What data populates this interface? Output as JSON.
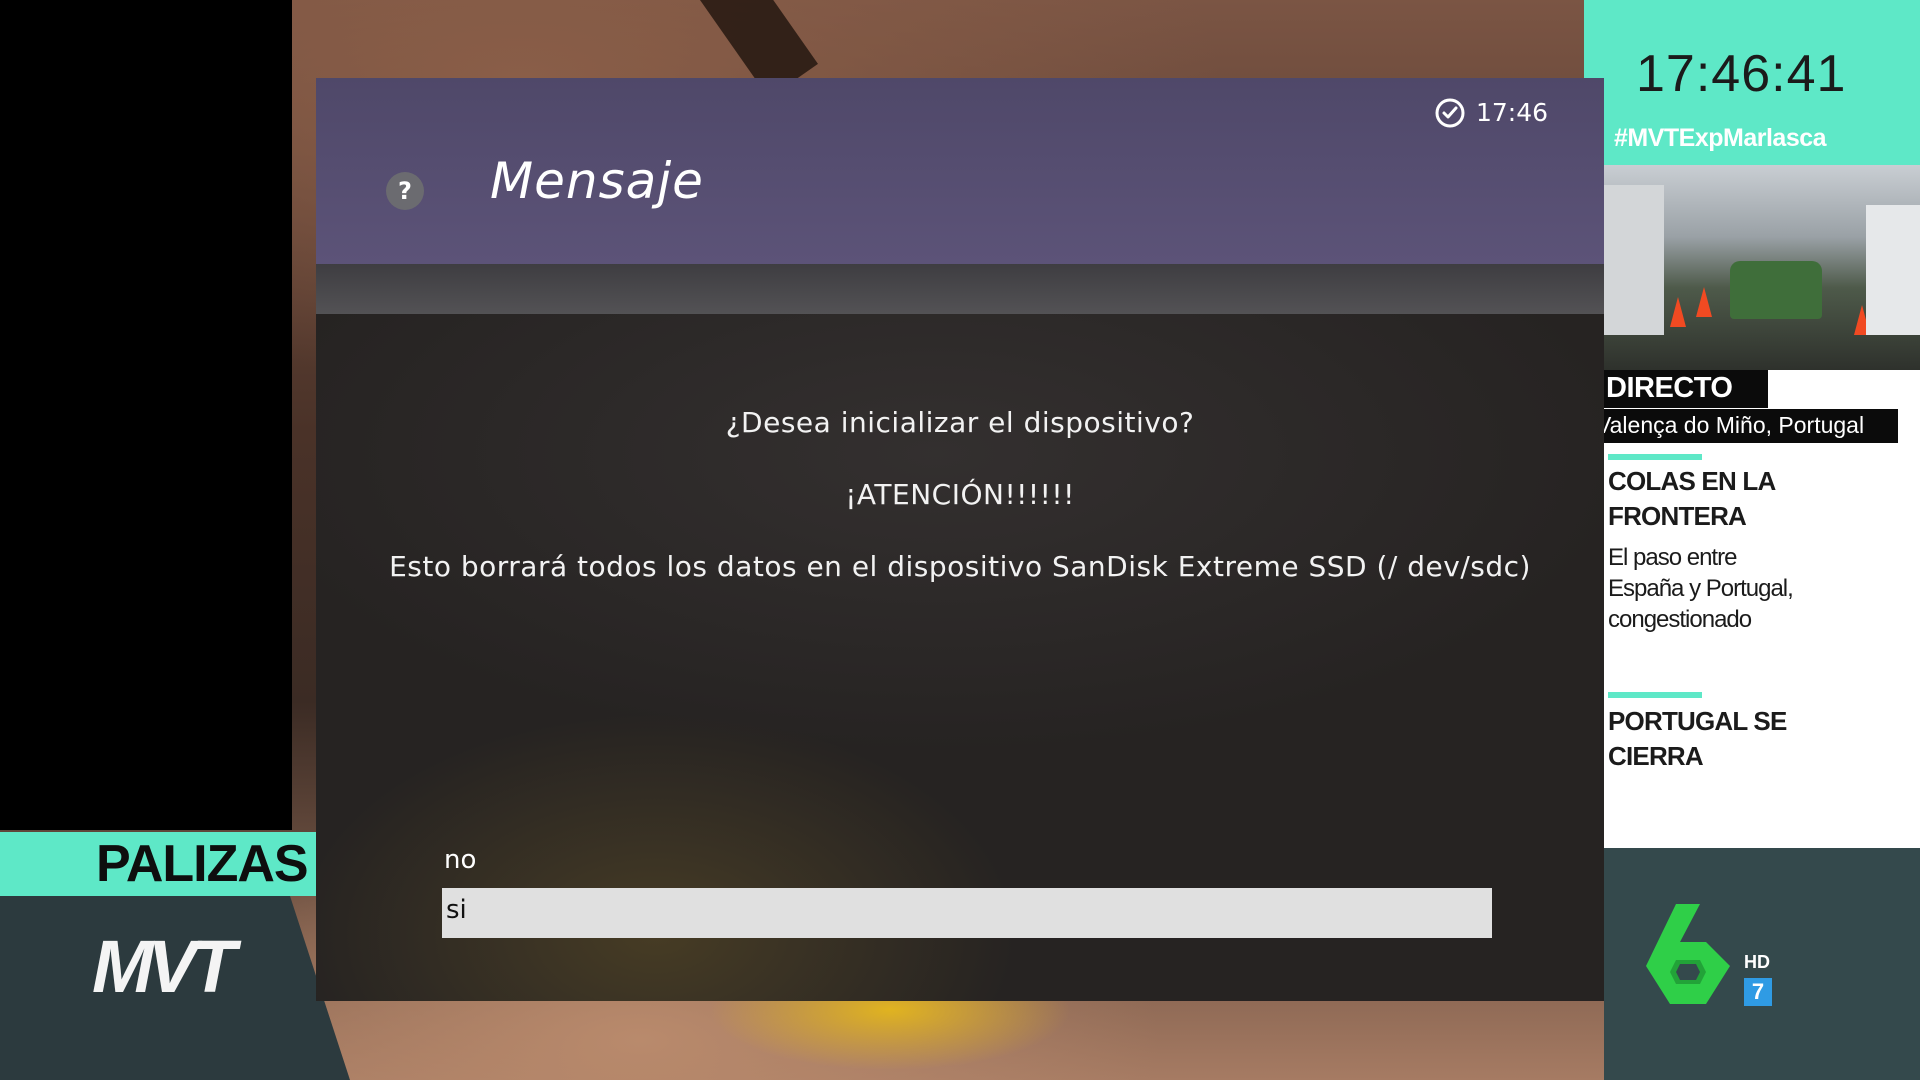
{
  "broadcast": {
    "side_clock": "17:46:41",
    "hashtag": "#MVTExpMarlasca",
    "live_label": "DIRECTO",
    "location": "Valença do Miño, Portugal",
    "headline1": "COLAS EN LA FRONTERA",
    "body1": "El paso entre España y Portugal, congestionado",
    "headline2": "PORTUGAL SE CIERRA",
    "ticker": "PALIZAS ENTRE ADOLESCENTES",
    "show_logo": "MVT",
    "hd_label": "HD",
    "hd_number": "7"
  },
  "dialog": {
    "title": "Mensaje",
    "help_glyph": "?",
    "time": "17:46",
    "lines": [
      "¿Desea inicializar el dispositivo?",
      "¡ATENCIÓN!!!!!!",
      "Esto borrará todos los datos en el dispositivo SanDisk Extreme SSD (/ dev/sdc)"
    ],
    "options": [
      "no",
      "si"
    ],
    "selected_option": "si"
  },
  "colors": {
    "header_purple": "#5c5378",
    "body_dark": "#262322",
    "selection": "#e0e0e0",
    "broadcast_teal": "#5ee8c7"
  }
}
